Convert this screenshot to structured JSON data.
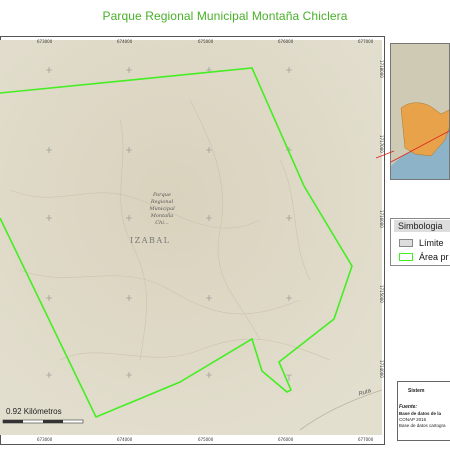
{
  "title": "Parque Regional Municipal Montaña Chiclera",
  "map": {
    "park_label": [
      "Parque",
      "Regional",
      "Municipal",
      "Montaña",
      "Chi..."
    ],
    "town_label": "IZABAL",
    "road_label": "Ruta",
    "coords_top": [
      "673000",
      "674000",
      "675000",
      "676000",
      "677000"
    ],
    "coords_bottom": [
      "673000",
      "674000",
      "675000",
      "676000",
      "677000"
    ],
    "coords_right": [
      "1718000",
      "1717000",
      "1716000",
      "1715000",
      "1714000"
    ],
    "scale_label": "0.92 Kilómetros",
    "colors": {
      "boundary": "#44ee22",
      "terrain": "#d8d2bf",
      "title": "#47b028",
      "pointer": "#e02020"
    }
  },
  "inset": {
    "colors": {
      "sea": "#8db3c9",
      "land": "#cfcab3",
      "highlight": "#e8a24a"
    }
  },
  "legend": {
    "title": "Simbologia",
    "items": [
      {
        "label": "Límite",
        "fill": "#dddddd",
        "border": "#888888"
      },
      {
        "label": "Área pr",
        "fill": "#ffffff",
        "border": "#44ee22"
      }
    ]
  },
  "info": {
    "heading": "Sistem",
    "source_label": "Fuente:",
    "lines": [
      "Base de datos de la",
      "CONAP 2016",
      "Base de datos cartogra"
    ]
  }
}
